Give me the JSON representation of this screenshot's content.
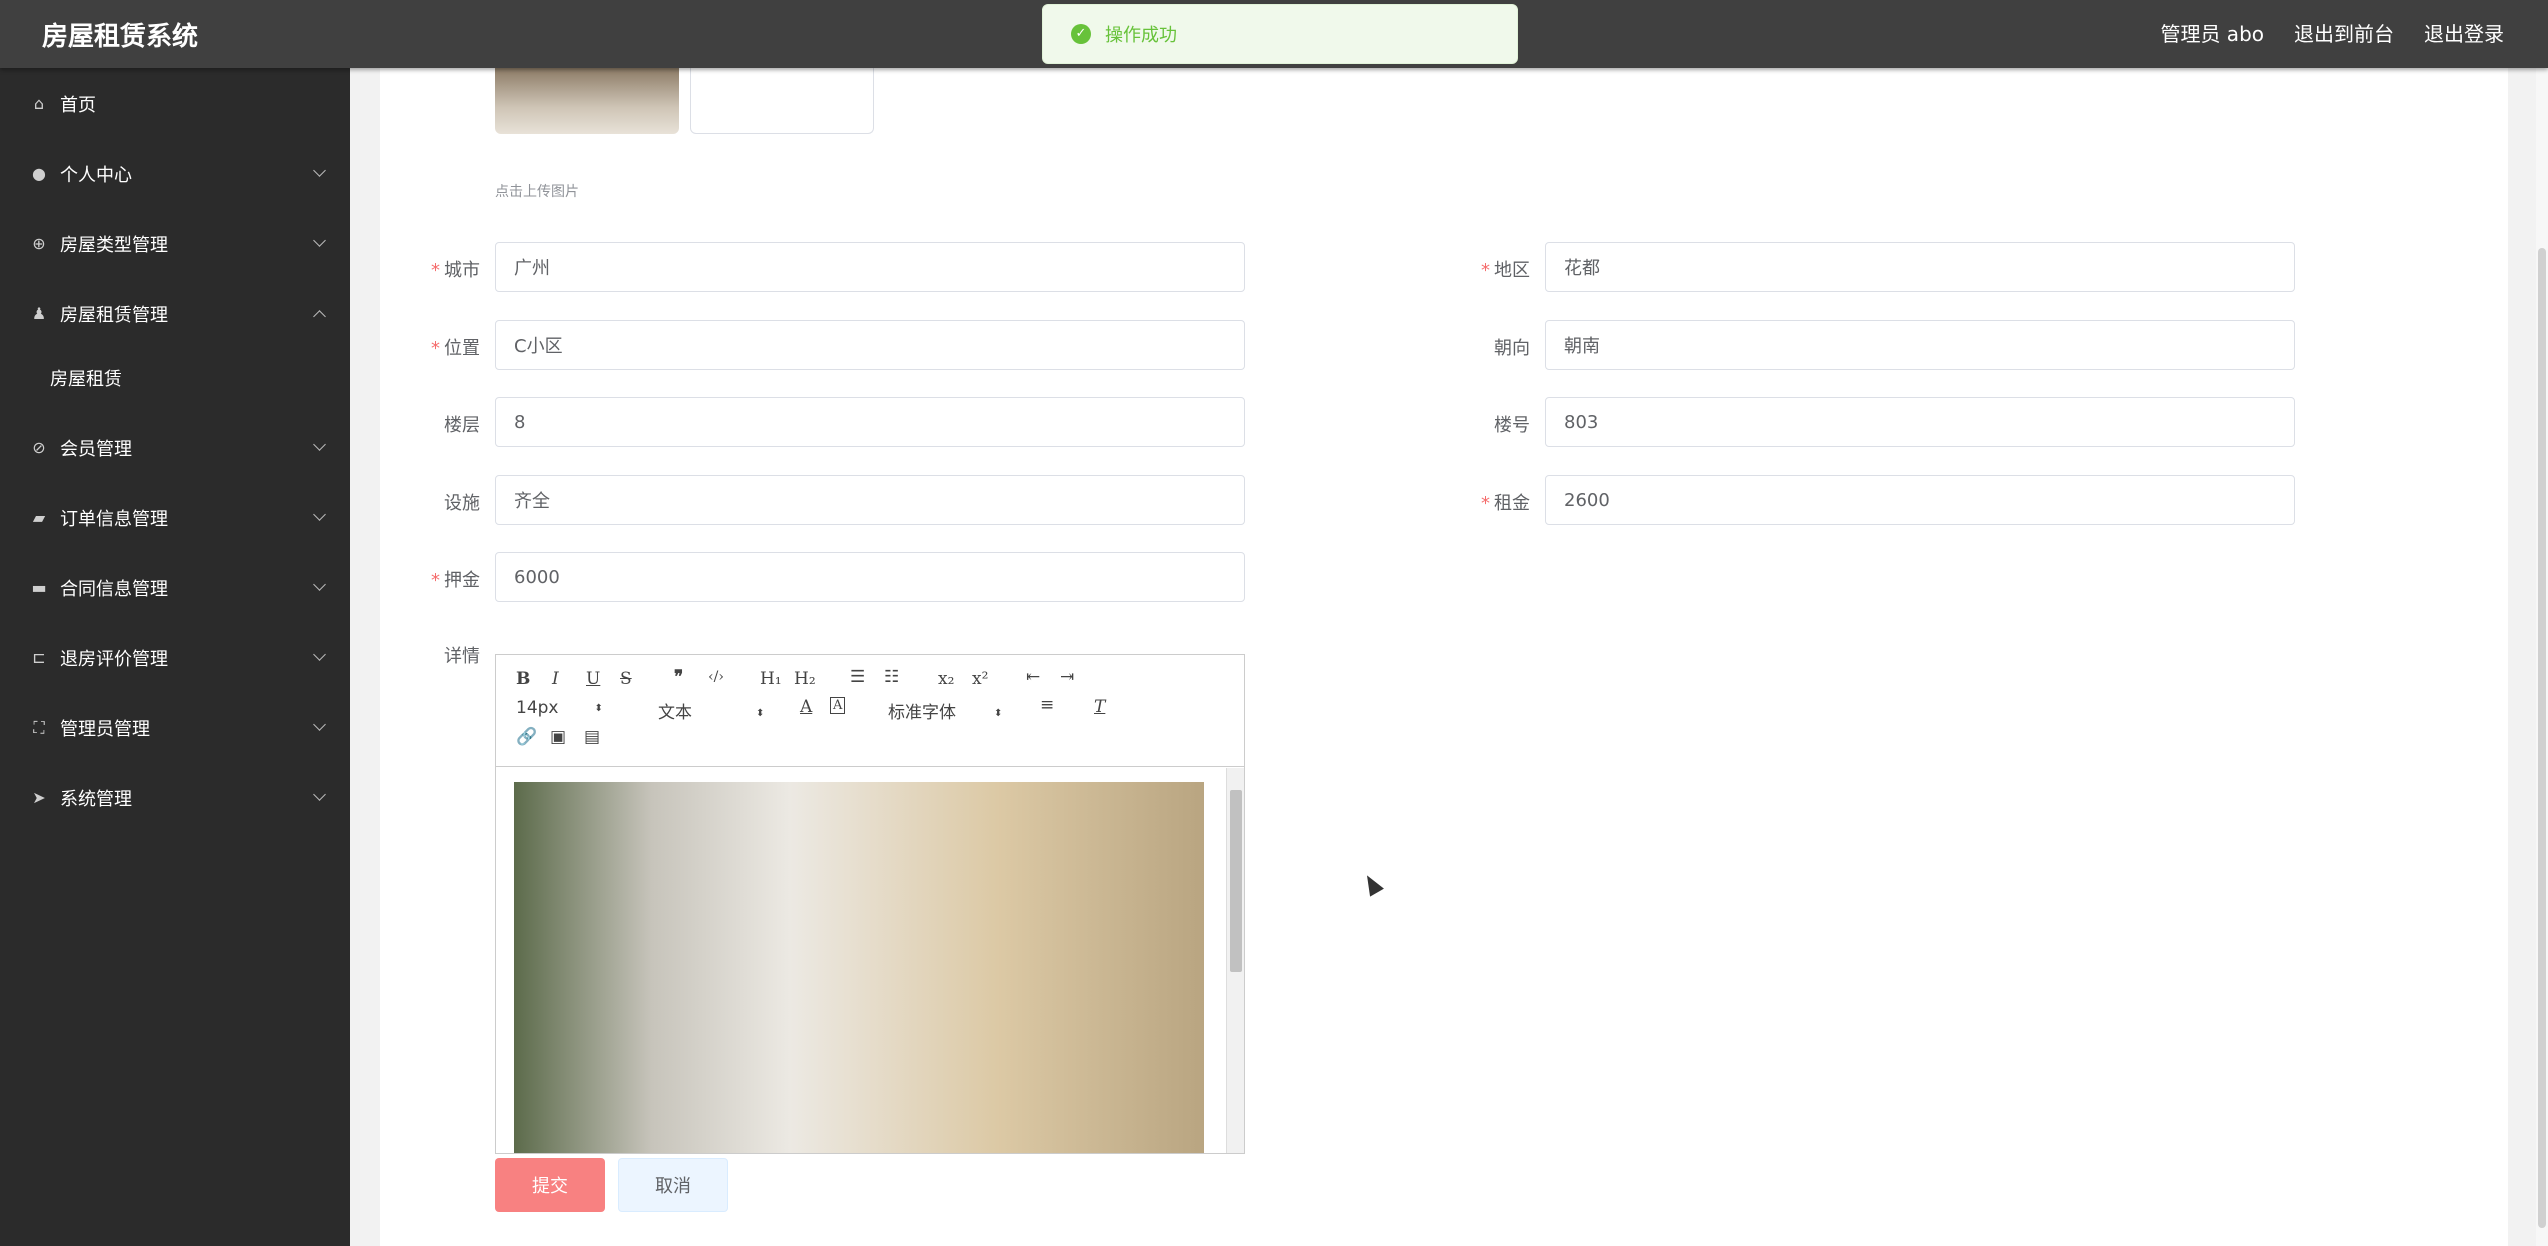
{
  "header": {
    "title": "房屋租赁系统",
    "user_label": "管理员 abo",
    "front_label": "退出到前台",
    "logout_label": "退出登录"
  },
  "toast": {
    "message": "操作成功"
  },
  "sidebar": {
    "items": [
      {
        "label": "首页",
        "icon": "home-icon"
      },
      {
        "label": "个人中心",
        "icon": "user-icon"
      },
      {
        "label": "房屋类型管理",
        "icon": "target-icon"
      },
      {
        "label": "房屋租赁管理",
        "icon": "person-icon",
        "expanded": true
      },
      {
        "label": "会员管理",
        "icon": "bell-off-icon"
      },
      {
        "label": "订单信息管理",
        "icon": "chart-icon"
      },
      {
        "label": "合同信息管理",
        "icon": "ticket-icon"
      },
      {
        "label": "退房评价管理",
        "icon": "crop-icon"
      },
      {
        "label": "管理员管理",
        "icon": "fullscreen-icon"
      },
      {
        "label": "系统管理",
        "icon": "send-icon"
      }
    ],
    "sub_item": "房屋租赁"
  },
  "form": {
    "upload_tip": "点击上传图片",
    "city": {
      "label": "城市",
      "value": "广州"
    },
    "district": {
      "label": "地区",
      "value": "花都"
    },
    "location": {
      "label": "位置",
      "value": "C小区"
    },
    "orientation": {
      "label": "朝向",
      "value": "朝南"
    },
    "floor": {
      "label": "楼层",
      "value": "8"
    },
    "building": {
      "label": "楼号",
      "value": "803"
    },
    "facilities": {
      "label": "设施",
      "value": "齐全"
    },
    "rent": {
      "label": "租金",
      "value": "2600"
    },
    "deposit": {
      "label": "押金",
      "value": "6000"
    },
    "detail_label": "详情",
    "required_mark": "*"
  },
  "editor": {
    "font_size": "14px",
    "format": "文本",
    "font_family": "标准字体",
    "toolbar_icons": [
      "bold-icon",
      "italic-icon",
      "underline-icon",
      "strike-icon",
      "quote-icon",
      "code-icon",
      "h1-icon",
      "h2-icon",
      "ordered-list-icon",
      "bullet-list-icon",
      "subscript-icon",
      "superscript-icon",
      "outdent-icon",
      "indent-icon",
      "font-color-icon",
      "background-color-icon",
      "align-icon",
      "clear-format-icon",
      "link-icon",
      "image-icon",
      "video-icon"
    ]
  },
  "actions": {
    "submit": "提交",
    "cancel": "取消"
  },
  "colors": {
    "submit_bg": "#f88181",
    "cancel_bg": "#ecf5ff",
    "sidebar_bg": "#2b2b2b",
    "topbar_bg": "#404040"
  }
}
